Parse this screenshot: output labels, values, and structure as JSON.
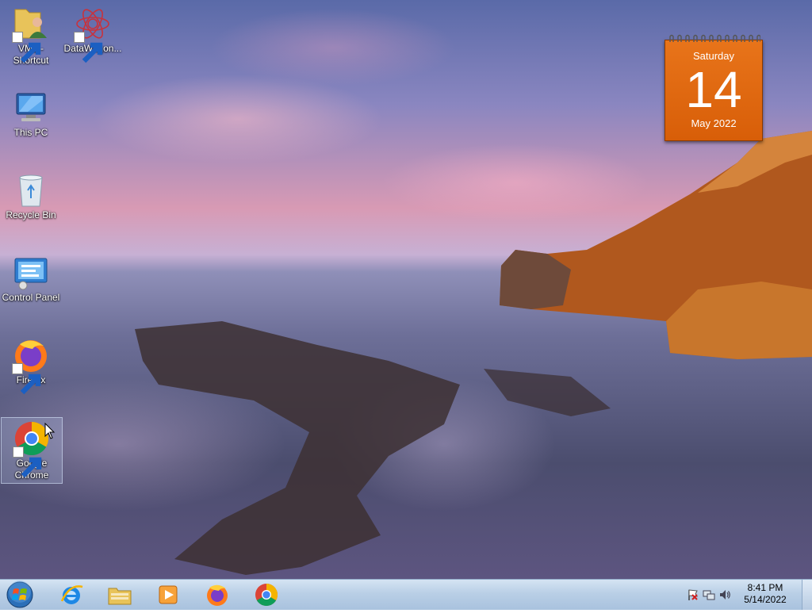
{
  "desktop": {
    "icons": [
      {
        "label": "VM1 - Shortcut"
      },
      {
        "label": "DataWagon..."
      },
      {
        "label": "This PC"
      },
      {
        "label": "Recycle Bin"
      },
      {
        "label": "Control Panel"
      },
      {
        "label": "Firefox"
      },
      {
        "label": "Google Chrome"
      }
    ]
  },
  "calendar_gadget": {
    "weekday": "Saturday",
    "day": "14",
    "month_year": "May 2022"
  },
  "taskbar": {
    "pinned": [
      "internet-explorer-icon",
      "file-explorer-icon",
      "media-player-icon",
      "firefox-icon",
      "chrome-icon"
    ],
    "clock": {
      "time": "8:41 PM",
      "date": "5/14/2022"
    }
  },
  "colors": {
    "calendar_orange": "#e06a10",
    "taskbar": "#b9cfe6"
  }
}
